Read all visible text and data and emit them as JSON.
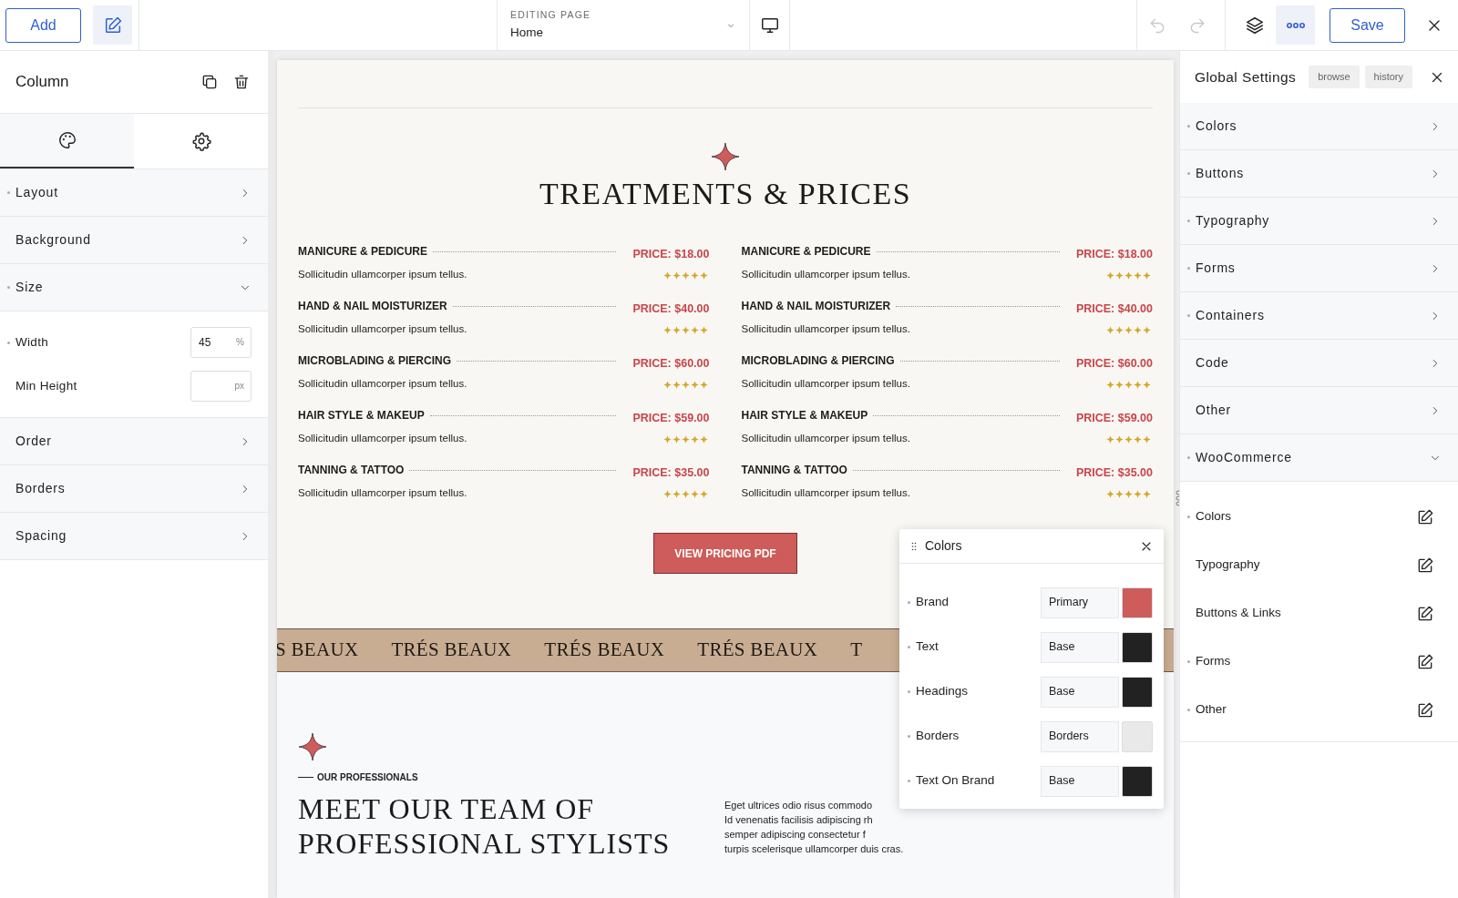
{
  "toolbar": {
    "add": "Add",
    "editing_label": "EDITING PAGE",
    "page": "Home",
    "save": "Save",
    "undo": {
      "disabled": true
    },
    "redo": {
      "disabled": true
    },
    "tools": [
      {
        "kind": "layers",
        "selected": false
      },
      {
        "kind": "more",
        "selected": true
      }
    ]
  },
  "left_panel": {
    "title": "Column",
    "tabs": [
      {
        "kind": "style",
        "selected": true
      },
      {
        "kind": "settings",
        "selected": false
      }
    ],
    "sections": [
      {
        "label": "Layout",
        "modified": true,
        "expanded": false
      },
      {
        "label": "Background",
        "modified": false,
        "expanded": false
      },
      {
        "label": "Size",
        "modified": true,
        "expanded": true,
        "fields": [
          {
            "label": "Width",
            "modified": true,
            "value": "45",
            "unit": "%"
          },
          {
            "label": "Min Height",
            "modified": false,
            "unit": "px"
          }
        ]
      },
      {
        "label": "Order",
        "modified": false,
        "expanded": false
      },
      {
        "label": "Borders",
        "modified": false,
        "expanded": false
      },
      {
        "label": "Spacing",
        "modified": false,
        "expanded": false
      }
    ]
  },
  "page": {
    "treatments": {
      "heading": "TREATMENTS & PRICES",
      "columns": [
        [
          {
            "name": "MANICURE & PEDICURE",
            "description": "Sollicitudin ullamcorper ipsum tellus.",
            "price": "PRICE: $18.00",
            "stars": 5
          },
          {
            "name": "HAND & NAIL MOISTURIZER",
            "description": "Sollicitudin ullamcorper ipsum tellus.",
            "price": "PRICE: $40.00",
            "stars": 5
          },
          {
            "name": "MICROBLADING & PIERCING",
            "description": "Sollicitudin ullamcorper ipsum tellus.",
            "price": "PRICE: $60.00",
            "stars": 5
          },
          {
            "name": "HAIR STYLE & MAKEUP",
            "description": "Sollicitudin ullamcorper ipsum tellus.",
            "price": "PRICE: $59.00",
            "stars": 5
          },
          {
            "name": "TANNING & TATTOO",
            "description": "Sollicitudin ullamcorper ipsum tellus.",
            "price": "PRICE: $35.00",
            "stars": 5
          }
        ],
        [
          {
            "name": "MANICURE & PEDICURE",
            "description": "Sollicitudin ullamcorper ipsum tellus.",
            "price": "PRICE: $18.00",
            "stars": 5
          },
          {
            "name": "HAND & NAIL MOISTURIZER",
            "description": "Sollicitudin ullamcorper ipsum tellus.",
            "price": "PRICE: $40.00",
            "stars": 5
          },
          {
            "name": "MICROBLADING & PIERCING",
            "description": "Sollicitudin ullamcorper ipsum tellus.",
            "price": "PRICE: $60.00",
            "stars": 5
          },
          {
            "name": "HAIR STYLE & MAKEUP",
            "description": "Sollicitudin ullamcorper ipsum tellus.",
            "price": "PRICE: $59.00",
            "stars": 5
          },
          {
            "name": "TANNING & TATTOO",
            "description": "Sollicitudin ullamcorper ipsum tellus.",
            "price": "PRICE: $35.00",
            "stars": 5
          }
        ]
      ],
      "button": "VIEW PRICING PDF"
    },
    "marquee": [
      "S BEAUX",
      "TRÉS BEAUX",
      "TRÉS BEAUX",
      "TRÉS BEAUX",
      "T"
    ],
    "team": {
      "eyebrow": "OUR PROFESSIONALS",
      "heading": "MEET OUR TEAM OF PROFESSIONAL STYLISTS",
      "paragraph_lines": [
        "Eget ultrices odio risus commodo",
        "Id venenatis facilisis adipiscing rh",
        "semper adipiscing consectetur f",
        "turpis scelerisque ullamcorper duis cras."
      ]
    }
  },
  "colors_popup": {
    "title": "Colors",
    "rows": [
      {
        "label": "Brand",
        "modified": true,
        "token": "Primary",
        "color": "#cd5c5a"
      },
      {
        "label": "Text",
        "modified": true,
        "token": "Base",
        "color": "#222222"
      },
      {
        "label": "Headings",
        "modified": true,
        "token": "Base",
        "color": "#222222"
      },
      {
        "label": "Borders",
        "modified": true,
        "token": "Borders",
        "color": "#e9e9e9"
      },
      {
        "label": "Text On Brand",
        "modified": true,
        "token": "Base",
        "color": "#222222"
      }
    ]
  },
  "right_panel": {
    "title": "Global Settings",
    "tags": [
      "browse",
      "history"
    ],
    "sections": [
      {
        "label": "Colors",
        "modified": true,
        "expanded": false
      },
      {
        "label": "Buttons",
        "modified": true,
        "expanded": false
      },
      {
        "label": "Typography",
        "modified": true,
        "expanded": false
      },
      {
        "label": "Forms",
        "modified": true,
        "expanded": false
      },
      {
        "label": "Containers",
        "modified": true,
        "expanded": false
      },
      {
        "label": "Code",
        "modified": false,
        "expanded": false
      },
      {
        "label": "Other",
        "modified": false,
        "expanded": false
      },
      {
        "label": "WooCommerce",
        "modified": true,
        "expanded": true,
        "children": [
          {
            "label": "Colors",
            "modified": true
          },
          {
            "label": "Typography",
            "modified": false
          },
          {
            "label": "Buttons & Links",
            "modified": false
          },
          {
            "label": "Forms",
            "modified": true
          },
          {
            "label": "Other",
            "modified": true
          }
        ]
      }
    ]
  }
}
